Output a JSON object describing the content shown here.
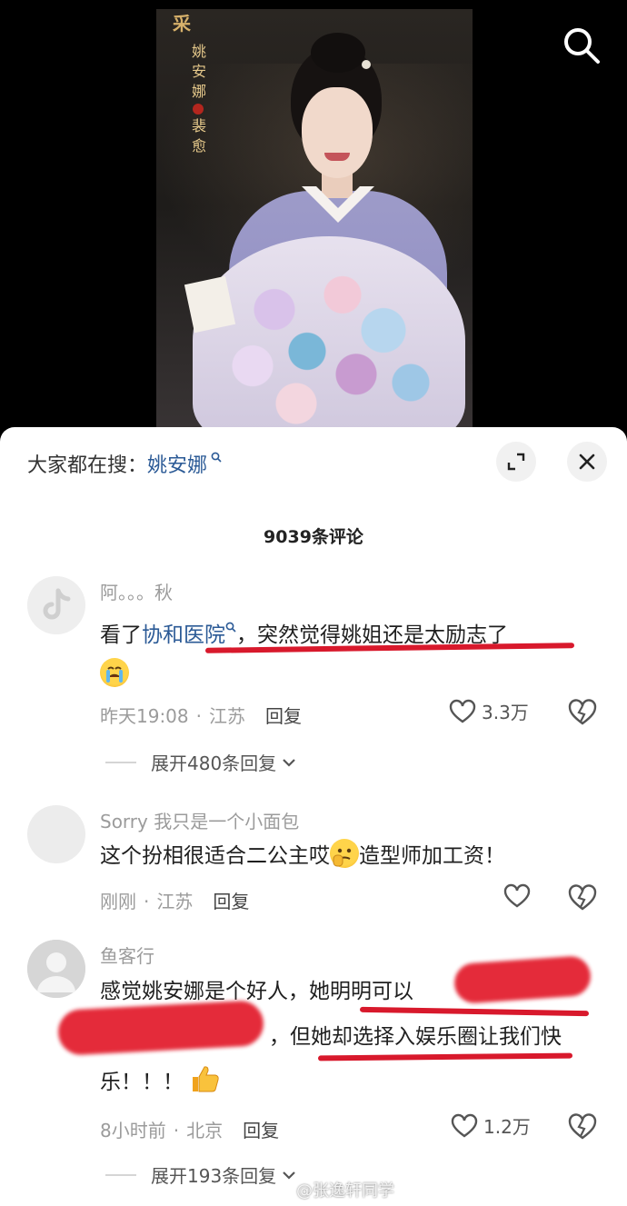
{
  "video": {
    "poster_title": "采",
    "poster_name": "姚安娜",
    "poster_name2": "裴愈"
  },
  "panel": {
    "search_prefix": "大家都在搜：",
    "search_keyword": "姚安娜",
    "comment_count": "9039条评论"
  },
  "comments": [
    {
      "author": "阿。。。秋",
      "text_before_link": "看了",
      "link_text": "协和医院",
      "text_after_link": "，突然觉得姚姐还是太励志了",
      "emoji": "loudly-crying-face",
      "time": "昨天19:08",
      "location": "江苏",
      "reply_label": "回复",
      "likes": "3.3万",
      "expand_replies": "展开480条回复"
    },
    {
      "author": "Sorry 我只是一个小面包",
      "text_before_emoji": "这个扮相很适合二公主哎",
      "emoji": "thinking-face",
      "text_after_emoji": "造型师加工资！",
      "time": "刚刚",
      "location": "江苏",
      "reply_label": "回复"
    },
    {
      "author": "鱼客行",
      "line1": "感觉姚安娜是个好人，她明明可以",
      "line2": "，但她却选择入娱乐圈让我们快",
      "line3": "乐！！！",
      "emoji": "thumbs-up",
      "time": "8小时前",
      "location": "北京",
      "reply_label": "回复",
      "likes": "1.2万",
      "expand_replies": "展开193条回复"
    }
  ],
  "watermark": "@张逸轩同学",
  "colors": {
    "link": "#2b5a96",
    "annotation_red": "#d8192c",
    "meta_gray": "#9b9b9b"
  },
  "icons": [
    "search-icon",
    "expand-icon",
    "close-icon",
    "heart-icon",
    "broken-heart-icon",
    "chevron-down-icon",
    "search-keyword-icon"
  ]
}
